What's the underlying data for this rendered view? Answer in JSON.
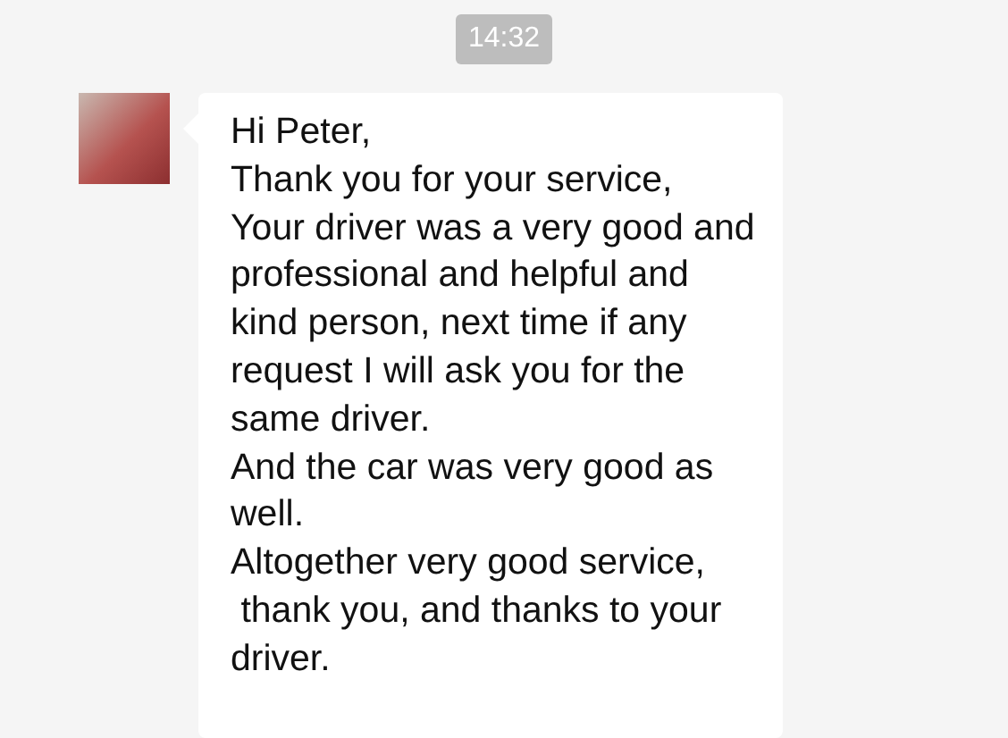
{
  "timestamp": "14:32",
  "message": {
    "paragraphs": [
      "Hi Peter,",
      "Thank you for your service,",
      "Your driver was a very good and professional and helpful and kind person, next time if any request I will ask you for the same driver.",
      "And the car was very good as well.",
      "Altogether very good service,",
      " thank you, and thanks to your driver."
    ]
  }
}
